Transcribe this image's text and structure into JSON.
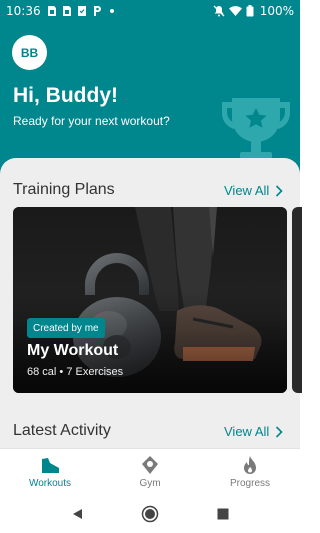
{
  "status_bar": {
    "time": "10:36",
    "battery": "100%"
  },
  "header": {
    "avatar_initials": "BB",
    "greeting": "Hi, Buddy!",
    "subtitle": "Ready for your next workout?"
  },
  "training_plans": {
    "title": "Training Plans",
    "view_all": "View All",
    "cards": [
      {
        "tag": "Created by me",
        "title": "My Workout",
        "meta": "68 cal • 7 Exercises"
      }
    ]
  },
  "latest_activity": {
    "title": "Latest Activity",
    "view_all": "View All"
  },
  "bottom_nav": {
    "items": [
      {
        "label": "Workouts",
        "icon": "shoe-icon",
        "active": true
      },
      {
        "label": "Gym",
        "icon": "location-pin-icon",
        "active": false
      },
      {
        "label": "Progress",
        "icon": "flame-icon",
        "active": false
      }
    ]
  },
  "colors": {
    "accent": "#00868d",
    "sheet_bg": "#eeeeee",
    "inactive_nav": "#7a7a7a"
  }
}
